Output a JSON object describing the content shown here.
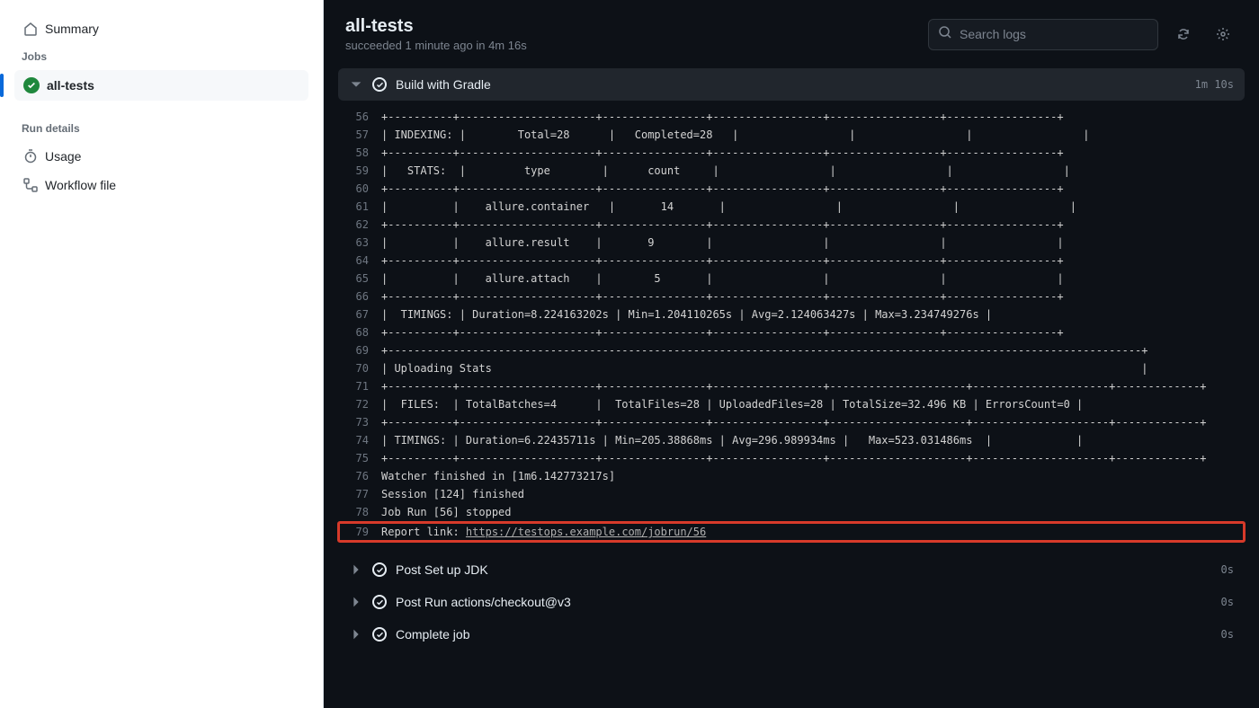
{
  "sidebar": {
    "summary_label": "Summary",
    "jobs_header": "Jobs",
    "job_all_tests": "all-tests",
    "run_details_header": "Run details",
    "usage_label": "Usage",
    "workflow_file_label": "Workflow file"
  },
  "header": {
    "title": "all-tests",
    "subtitle_status": "succeeded",
    "subtitle_when": "1 minute ago",
    "subtitle_in": "in",
    "subtitle_duration": "4m 16s",
    "search_placeholder": "Search logs"
  },
  "steps": {
    "build_gradle": {
      "title": "Build with Gradle",
      "time": "1m 10s"
    },
    "post_jdk": {
      "title": "Post Set up JDK",
      "time": "0s"
    },
    "post_checkout": {
      "title": "Post Run actions/checkout@v3",
      "time": "0s"
    },
    "complete_job": {
      "title": "Complete job",
      "time": "0s"
    }
  },
  "log_lines": [
    {
      "num": 56,
      "text": "+----------+---------------------+----------------+-----------------+-----------------+-----------------+"
    },
    {
      "num": 57,
      "text": "| INDEXING: |        Total=28      |   Completed=28   |                 |                 |                 |"
    },
    {
      "num": 58,
      "text": "+----------+---------------------+----------------+-----------------+-----------------+-----------------+"
    },
    {
      "num": 59,
      "text": "|   STATS:  |         type        |      count     |                 |                 |                 |"
    },
    {
      "num": 60,
      "text": "+----------+---------------------+----------------+-----------------+-----------------+-----------------+"
    },
    {
      "num": 61,
      "text": "|          |    allure.container   |       14       |                 |                 |                 |"
    },
    {
      "num": 62,
      "text": "+----------+---------------------+----------------+-----------------+-----------------+-----------------+"
    },
    {
      "num": 63,
      "text": "|          |    allure.result    |       9        |                 |                 |                 |"
    },
    {
      "num": 64,
      "text": "+----------+---------------------+----------------+-----------------+-----------------+-----------------+"
    },
    {
      "num": 65,
      "text": "|          |    allure.attach    |        5       |                 |                 |                 |"
    },
    {
      "num": 66,
      "text": "+----------+---------------------+----------------+-----------------+-----------------+-----------------+"
    },
    {
      "num": 67,
      "text": "|  TIMINGS: | Duration=8.224163202s | Min=1.204110265s | Avg=2.124063427s | Max=3.234749276s |"
    },
    {
      "num": 68,
      "text": "+----------+---------------------+----------------+-----------------+-----------------+-----------------+"
    },
    {
      "num": 69,
      "text": "+--------------------------------------------------------------------------------------------------------------------+"
    },
    {
      "num": 70,
      "text": "| Uploading Stats                                                                                                    |"
    },
    {
      "num": 71,
      "text": "+----------+---------------------+----------------+-----------------+---------------------+---------------------+-------------+"
    },
    {
      "num": 72,
      "text": "|  FILES:  | TotalBatches=4      |  TotalFiles=28 | UploadedFiles=28 | TotalSize=32.496 KB | ErrorsCount=0 |"
    },
    {
      "num": 73,
      "text": "+----------+---------------------+----------------+-----------------+---------------------+---------------------+-------------+"
    },
    {
      "num": 74,
      "text": "| TIMINGS: | Duration=6.22435711s | Min=205.38868ms | Avg=296.989934ms |   Max=523.031486ms  |             |"
    },
    {
      "num": 75,
      "text": "+----------+---------------------+----------------+-----------------+---------------------+---------------------+-------------+"
    },
    {
      "num": 76,
      "text": "Watcher finished in [1m6.142773217s]"
    },
    {
      "num": 77,
      "text": "Session [124] finished"
    },
    {
      "num": 78,
      "text": "Job Run [56] stopped"
    }
  ],
  "report_line": {
    "num": 79,
    "prefix": "Report link: ",
    "url": "https://testops.example.com/jobrun/56"
  }
}
